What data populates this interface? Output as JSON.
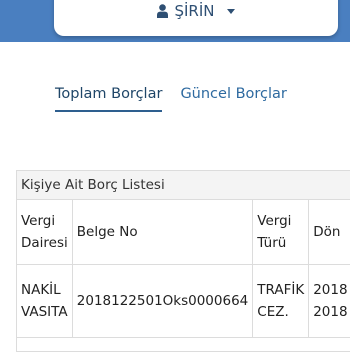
{
  "header": {
    "user_name": "ŞİRİN",
    "user_icon": "user-icon",
    "dropdown_icon": "caret-down-icon",
    "band_color": "#4a7fc0"
  },
  "tabs": [
    {
      "label": "Toplam Borçlar",
      "active": true
    },
    {
      "label": "Güncel Borçlar",
      "active": false
    }
  ],
  "debt_list": {
    "title": "Kişiye Ait Borç Listesi",
    "columns": [
      {
        "line1": "Vergi",
        "line2": "Dairesi"
      },
      {
        "line1": "Belge No",
        "line2": ""
      },
      {
        "line1": "Vergi",
        "line2": "Türü"
      },
      {
        "line1": "Dön",
        "line2": ""
      }
    ],
    "rows": [
      {
        "vergi_dairesi": {
          "line1": "NAKİL",
          "line2": "VASITA"
        },
        "belge_no": "2018122501Oks0000664",
        "vergi_turu": {
          "line1": "TRAFİK",
          "line2": "CEZ."
        },
        "donem": {
          "line1": "2018",
          "line2": "2018"
        }
      }
    ]
  }
}
